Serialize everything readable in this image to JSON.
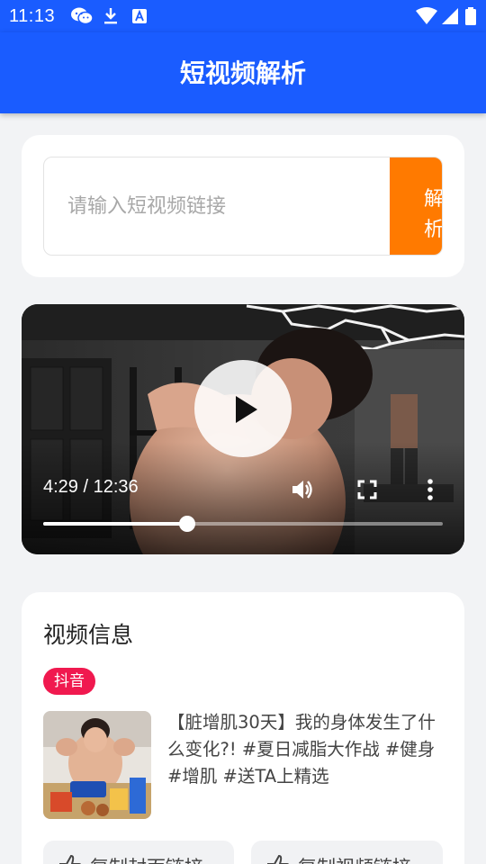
{
  "status_bar": {
    "time": "11:13",
    "icons": [
      "wechat-icon",
      "download-icon",
      "text-a-icon",
      "wifi-icon",
      "signal-icon",
      "battery-icon"
    ]
  },
  "app_bar": {
    "title": "短视频解析"
  },
  "link_input": {
    "placeholder": "请输入短视频链接",
    "value": "",
    "parse_button": "解析"
  },
  "player": {
    "time_readout": "4:29 / 12:36",
    "progress_fraction": 0.36,
    "icons": [
      "play-icon",
      "volume-icon",
      "fullscreen-icon",
      "more-vertical-icon"
    ]
  },
  "video_info": {
    "heading": "视频信息",
    "platform": "抖音",
    "description": "【脏增肌30天】我的身体发生了什么变化?! #夏日减脂大作战 #健身 #增肌 #送TA上精选",
    "copy_cover_label": "复制封面链接",
    "copy_video_label": "复制视频链接"
  },
  "colors": {
    "primary": "#1a5cff",
    "accent": "#ff7a00",
    "badge": "#f0194f"
  }
}
